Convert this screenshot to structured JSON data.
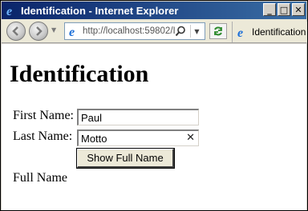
{
  "window": {
    "title": "Identification - Internet Explorer",
    "minimize_glyph": "_",
    "maximize_glyph": "□",
    "close_glyph": "✕"
  },
  "toolbar": {
    "address_url": "http://localhost:59802/I",
    "tab_label": "Identification"
  },
  "page": {
    "heading": "Identification",
    "first_name_label": "First Name:",
    "first_name_value": "Paul",
    "last_name_label": "Last Name:",
    "last_name_value": "Motto",
    "button_label": "Show Full Name",
    "full_name_label": "Full Name"
  },
  "colors": {
    "titlebar_start": "#0a246a",
    "titlebar_end": "#3a6ea5",
    "ie_blue": "#1c6fd8"
  },
  "icons": {
    "back": "back-arrow-icon",
    "forward": "forward-arrow-icon",
    "search": "search-icon",
    "refresh": "refresh-icon",
    "clear": "clear-icon"
  }
}
